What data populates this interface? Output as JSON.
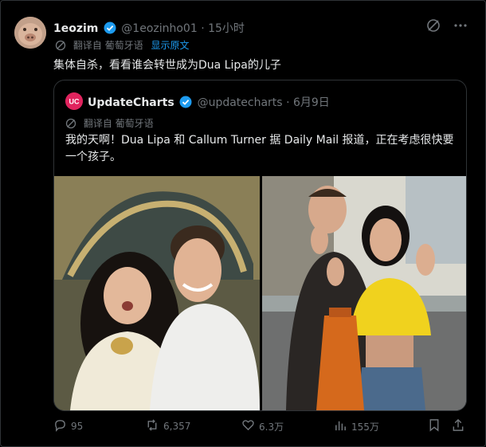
{
  "tweet": {
    "display_name": "1eozim",
    "handle": "@1eozinho01",
    "separator": "·",
    "time": "15小时",
    "translate_label": "翻译自 葡萄牙语",
    "show_original": "显示原文",
    "text": "集体自杀，看看谁会转世成为Dua Lipa的儿子",
    "avatar_icon": "pig-face-icon"
  },
  "quote": {
    "display_name": "UpdateCharts",
    "handle": "@updatecharts",
    "separator": "·",
    "time": "6月9日",
    "translate_label": "翻译自 葡萄牙语",
    "text": "我的天啊！Dua Lipa 和 Callum Turner 据 Daily Mail 报道，正在考虑很快要一个孩子。",
    "avatar_text": "UC",
    "photos": [
      "couple-selfie-photo",
      "couple-street-photo"
    ]
  },
  "actions": {
    "replies": "95",
    "reposts": "6,357",
    "likes": "6.3万",
    "views": "155万"
  },
  "colors": {
    "background": "#000000",
    "accent": "#1d9bf0",
    "muted": "#71767b",
    "text": "#e7e9ea",
    "border": "#2f3336"
  }
}
